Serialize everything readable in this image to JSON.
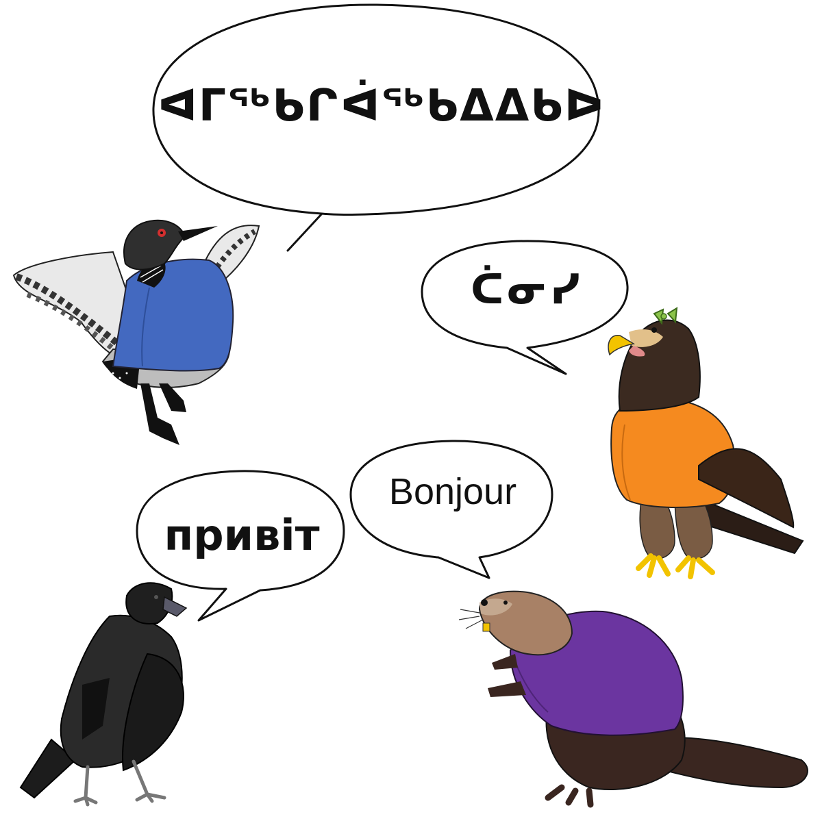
{
  "scene": {
    "speech_bubbles": [
      {
        "speaker": "loon",
        "text": "ᐊᒥᖅᑲᒋᐋᖅᑲᐃᐃᑲᐅ"
      },
      {
        "speaker": "eagle",
        "text": "ᑖᓂᓯ"
      },
      {
        "speaker": "raven",
        "text": "привіт"
      },
      {
        "speaker": "beaver",
        "text": "Bonjour"
      }
    ]
  },
  "colors": {
    "loon_sweater": "#4369c0",
    "eagle_sweater": "#f58a1f",
    "beaver_sweater": "#6b35a0",
    "bubble_outline": "#111111",
    "bow": "#8bc34a"
  },
  "icons": [
    "loon-icon",
    "eagle-icon",
    "raven-icon",
    "beaver-icon"
  ]
}
